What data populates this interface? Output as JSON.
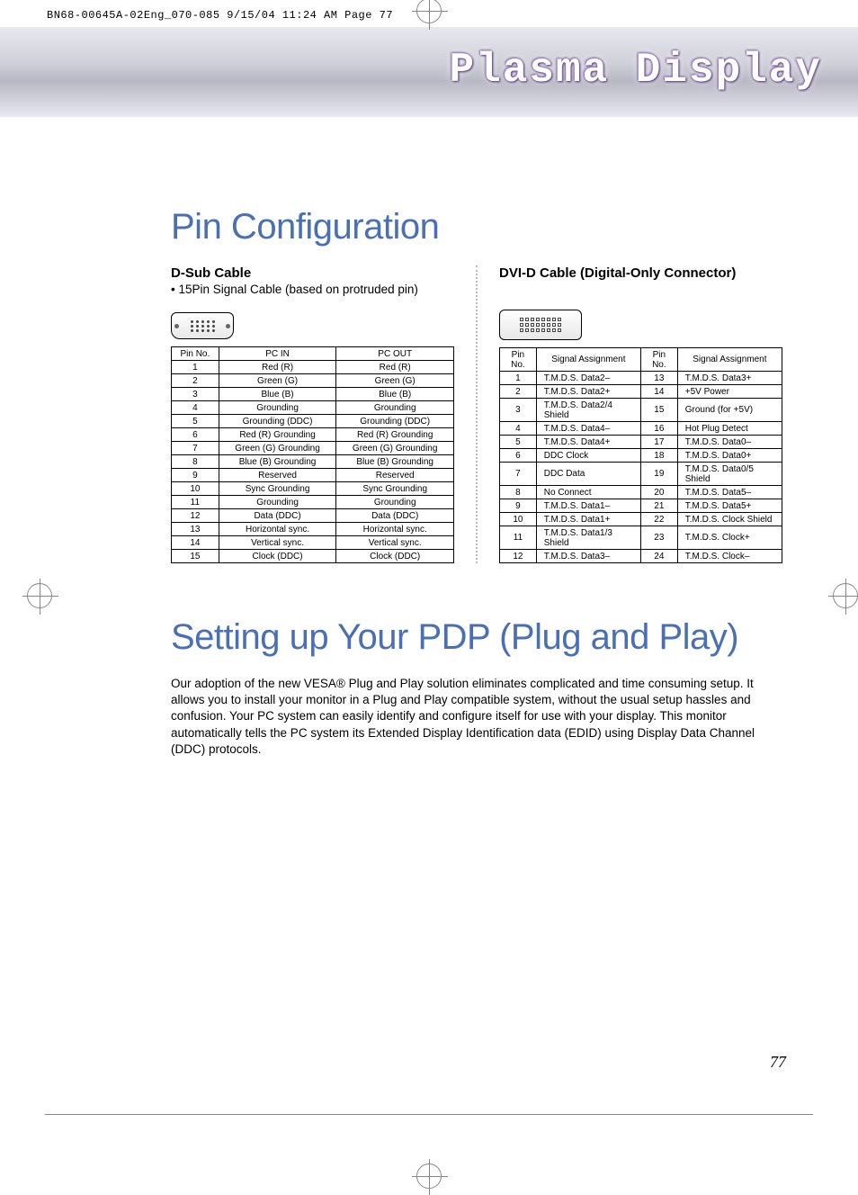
{
  "print_meta": "BN68-00645A-02Eng_070-085  9/15/04  11:24 AM  Page 77",
  "header_title": "Plasma Display",
  "heading1": "Pin Configuration",
  "dsub": {
    "title": "D-Sub Cable",
    "note": "• 15Pin Signal Cable (based on protruded pin)",
    "headers": [
      "Pin No.",
      "PC IN",
      "PC OUT"
    ],
    "rows": [
      [
        "1",
        "Red (R)",
        "Red (R)"
      ],
      [
        "2",
        "Green (G)",
        "Green (G)"
      ],
      [
        "3",
        "Blue (B)",
        "Blue (B)"
      ],
      [
        "4",
        "Grounding",
        "Grounding"
      ],
      [
        "5",
        "Grounding (DDC)",
        "Grounding (DDC)"
      ],
      [
        "6",
        "Red (R) Grounding",
        "Red (R) Grounding"
      ],
      [
        "7",
        "Green (G) Grounding",
        "Green (G) Grounding"
      ],
      [
        "8",
        "Blue (B) Grounding",
        "Blue (B) Grounding"
      ],
      [
        "9",
        "Reserved",
        "Reserved"
      ],
      [
        "10",
        "Sync Grounding",
        "Sync Grounding"
      ],
      [
        "11",
        "Grounding",
        "Grounding"
      ],
      [
        "12",
        "Data (DDC)",
        "Data (DDC)"
      ],
      [
        "13",
        "Horizontal sync.",
        "Horizontal sync."
      ],
      [
        "14",
        "Vertical sync.",
        "Vertical sync."
      ],
      [
        "15",
        "Clock (DDC)",
        "Clock (DDC)"
      ]
    ]
  },
  "dvi": {
    "title": "DVI-D Cable (Digital-Only Connector)",
    "headers": [
      "Pin No.",
      "Signal Assignment",
      "Pin No.",
      "Signal Assignment"
    ],
    "rows": [
      [
        "1",
        "T.M.D.S. Data2–",
        "13",
        "T.M.D.S. Data3+"
      ],
      [
        "2",
        "T.M.D.S. Data2+",
        "14",
        "+5V Power"
      ],
      [
        "3",
        "T.M.D.S. Data2/4 Shield",
        "15",
        "Ground (for +5V)"
      ],
      [
        "4",
        "T.M.D.S. Data4–",
        "16",
        "Hot Plug Detect"
      ],
      [
        "5",
        "T.M.D.S. Data4+",
        "17",
        "T.M.D.S. Data0–"
      ],
      [
        "6",
        "DDC  Clock",
        "18",
        "T.M.D.S. Data0+"
      ],
      [
        "7",
        "DDC Data",
        "19",
        "T.M.D.S. Data0/5 Shield"
      ],
      [
        "8",
        "No Connect",
        "20",
        "T.M.D.S. Data5–"
      ],
      [
        "9",
        "T.M.D.S. Data1–",
        "21",
        "T.M.D.S. Data5+"
      ],
      [
        "10",
        "T.M.D.S. Data1+",
        "22",
        "T.M.D.S. Clock Shield"
      ],
      [
        "11",
        "T.M.D.S. Data1/3 Shield",
        "23",
        "T.M.D.S. Clock+"
      ],
      [
        "12",
        "T.M.D.S. Data3–",
        "24",
        "T.M.D.S. Clock–"
      ]
    ]
  },
  "heading2": "Setting up Your PDP (Plug and Play)",
  "body": "Our adoption of the new VESA® Plug and Play solution eliminates complicated and time consuming setup. It allows you to install your monitor in a Plug and Play compatible system, without the usual setup hassles and confusion. Your PC system can easily identify and configure itself for use with your display. This monitor automatically tells the PC system its Extended Display Identification data (EDID) using Display Data Channel (DDC) protocols.",
  "page_number": "77"
}
